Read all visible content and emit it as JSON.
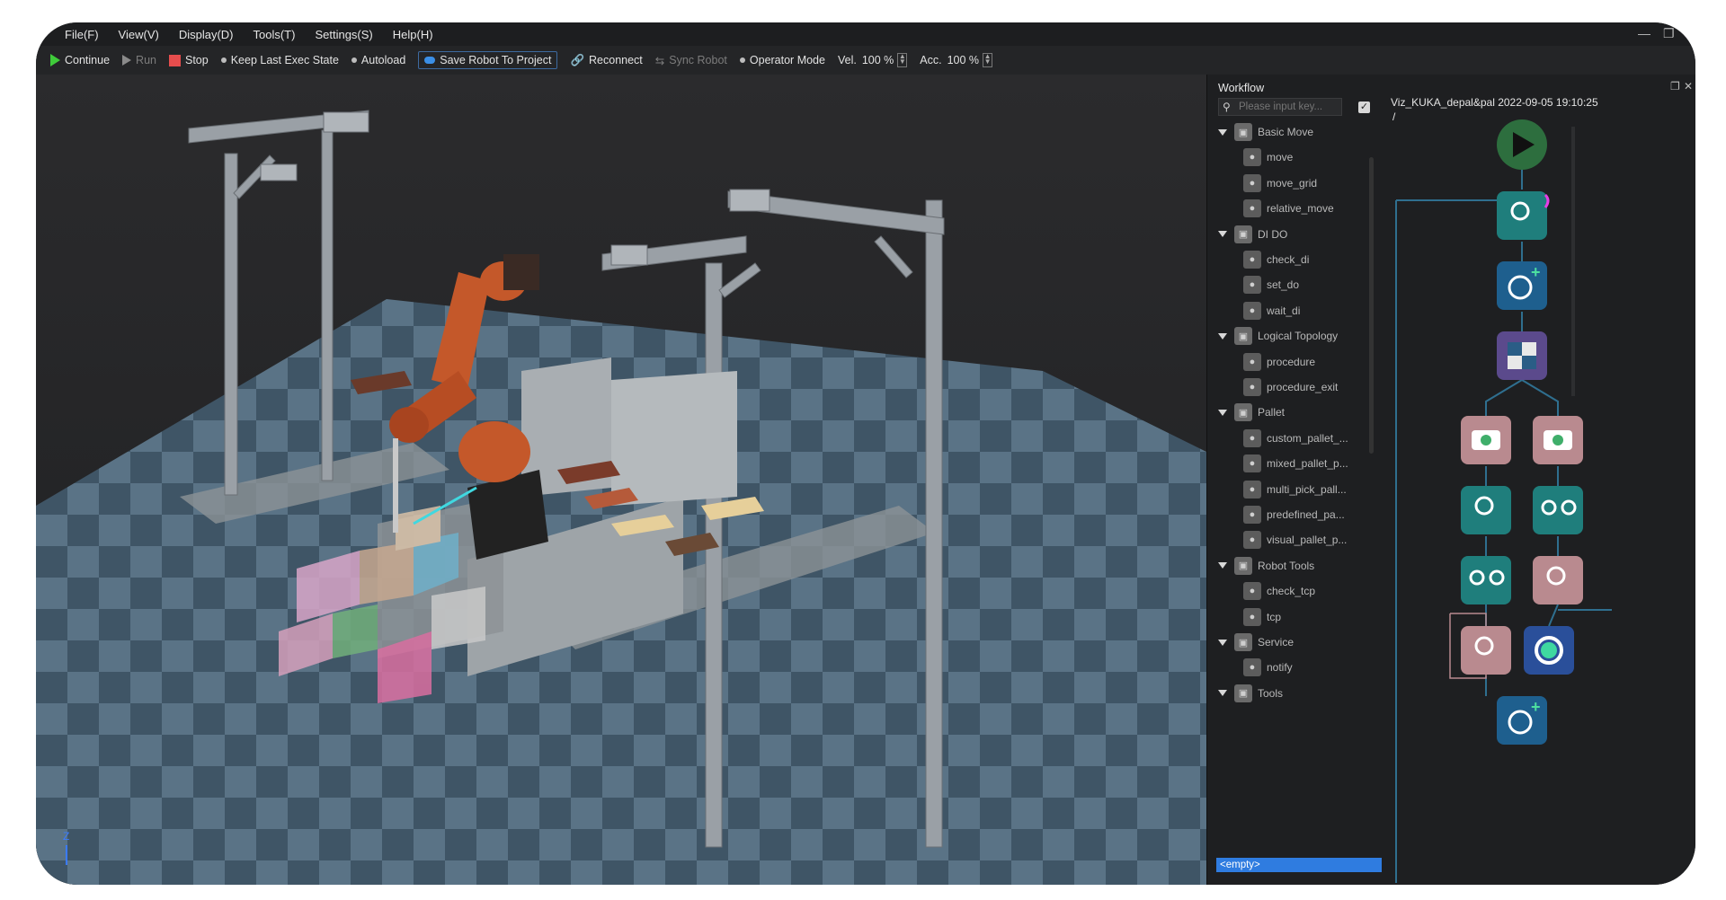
{
  "menubar": {
    "items": [
      "File(F)",
      "View(V)",
      "Display(D)",
      "Tools(T)",
      "Settings(S)",
      "Help(H)"
    ]
  },
  "toolbar": {
    "continue": "Continue",
    "run": "Run",
    "stop": "Stop",
    "keep_last": "Keep Last Exec State",
    "autoload": "Autoload",
    "save_robot": "Save Robot To Project",
    "reconnect": "Reconnect",
    "sync_robot": "Sync Robot",
    "operator_mode": "Operator Mode",
    "vel_label": "Vel.",
    "vel_value": "100 %",
    "acc_label": "Acc.",
    "acc_value": "100 %"
  },
  "workflow": {
    "title": "Workflow",
    "search_placeholder": "Please input key...",
    "project_title": "Viz_KUKA_depal&pal 2022-09-05 19:10:25",
    "project_path": "/",
    "empty_label": "<empty>",
    "categories": [
      {
        "label": "Basic Move",
        "items": [
          "move",
          "move_grid",
          "relative_move"
        ]
      },
      {
        "label": "DI DO",
        "items": [
          "check_di",
          "set_do",
          "wait_di"
        ]
      },
      {
        "label": "Logical Topology",
        "items": [
          "procedure",
          "procedure_exit"
        ]
      },
      {
        "label": "Pallet",
        "items": [
          "custom_pallet_...",
          "mixed_pallet_p...",
          "multi_pick_pall...",
          "predefined_pa...",
          "visual_pallet_p..."
        ]
      },
      {
        "label": "Robot Tools",
        "items": [
          "check_tcp",
          "tcp"
        ]
      },
      {
        "label": "Service",
        "items": [
          "notify"
        ]
      },
      {
        "label": "Tools",
        "items": []
      }
    ]
  },
  "viewport": {
    "axis_label": "Z"
  },
  "colors": {
    "accent_green": "#3fcb3a",
    "stop_red": "#e64d4d",
    "selection_blue": "#2f7ce0",
    "node_teal": "#1f7e7c",
    "node_blue": "#1e5f8e",
    "node_purple": "#5b4a8c",
    "node_pink": "#b98a8f",
    "robot_orange": "#c4582a"
  }
}
